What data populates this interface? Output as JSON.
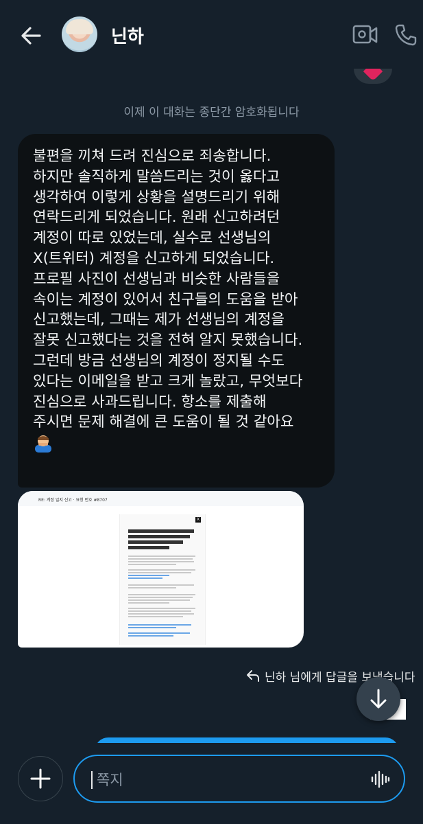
{
  "header": {
    "title": "닌하"
  },
  "encryption_notice": "이제 이 대화는 종단간 암호화됩니다",
  "message": {
    "lines": [
      "불편을 끼쳐 드려 진심으로 죄송합니다.",
      "하지만 솔직하게 말씀드리는 것이 옳다고",
      "생각하여 이렇게 상황을 설명드리기 위해",
      "연락드리게 되었습니다. 원래 신고하려던",
      "계정이 따로 있었는데, 실수로 선생님의",
      "X(트위터) 계정을 신고하게 되었습니다.",
      "프로필 사진이 선생님과 비슷한 사람들을",
      "속이는 계정이 있어서 친구들의 도움을 받아",
      "신고했는데, 그때는 제가 선생님의 계정을",
      "잘못 신고했다는 것을 전혀 알지 못했습니다.",
      "그런데 방금 선생님의 계정이 정지될 수도",
      "있다는 이메일을 받고 크게 놀랐고, 무엇보다",
      "진심으로 사과드립니다. 항소를 제출해",
      "주시면 문제 해결에 큰 도움이 될 것 같아요"
    ],
    "emoji": "bowing-person"
  },
  "image_attachment": {
    "subject": "RE: 계정 일지 신고 · 요청 번호 #8707"
  },
  "reply_note": "닌하 님에게 답글을 보냈습니다",
  "composer": {
    "placeholder": "쪽지"
  },
  "colors": {
    "background": "#15202b",
    "bubble": "#0d1114",
    "accent": "#1d9bf0"
  }
}
